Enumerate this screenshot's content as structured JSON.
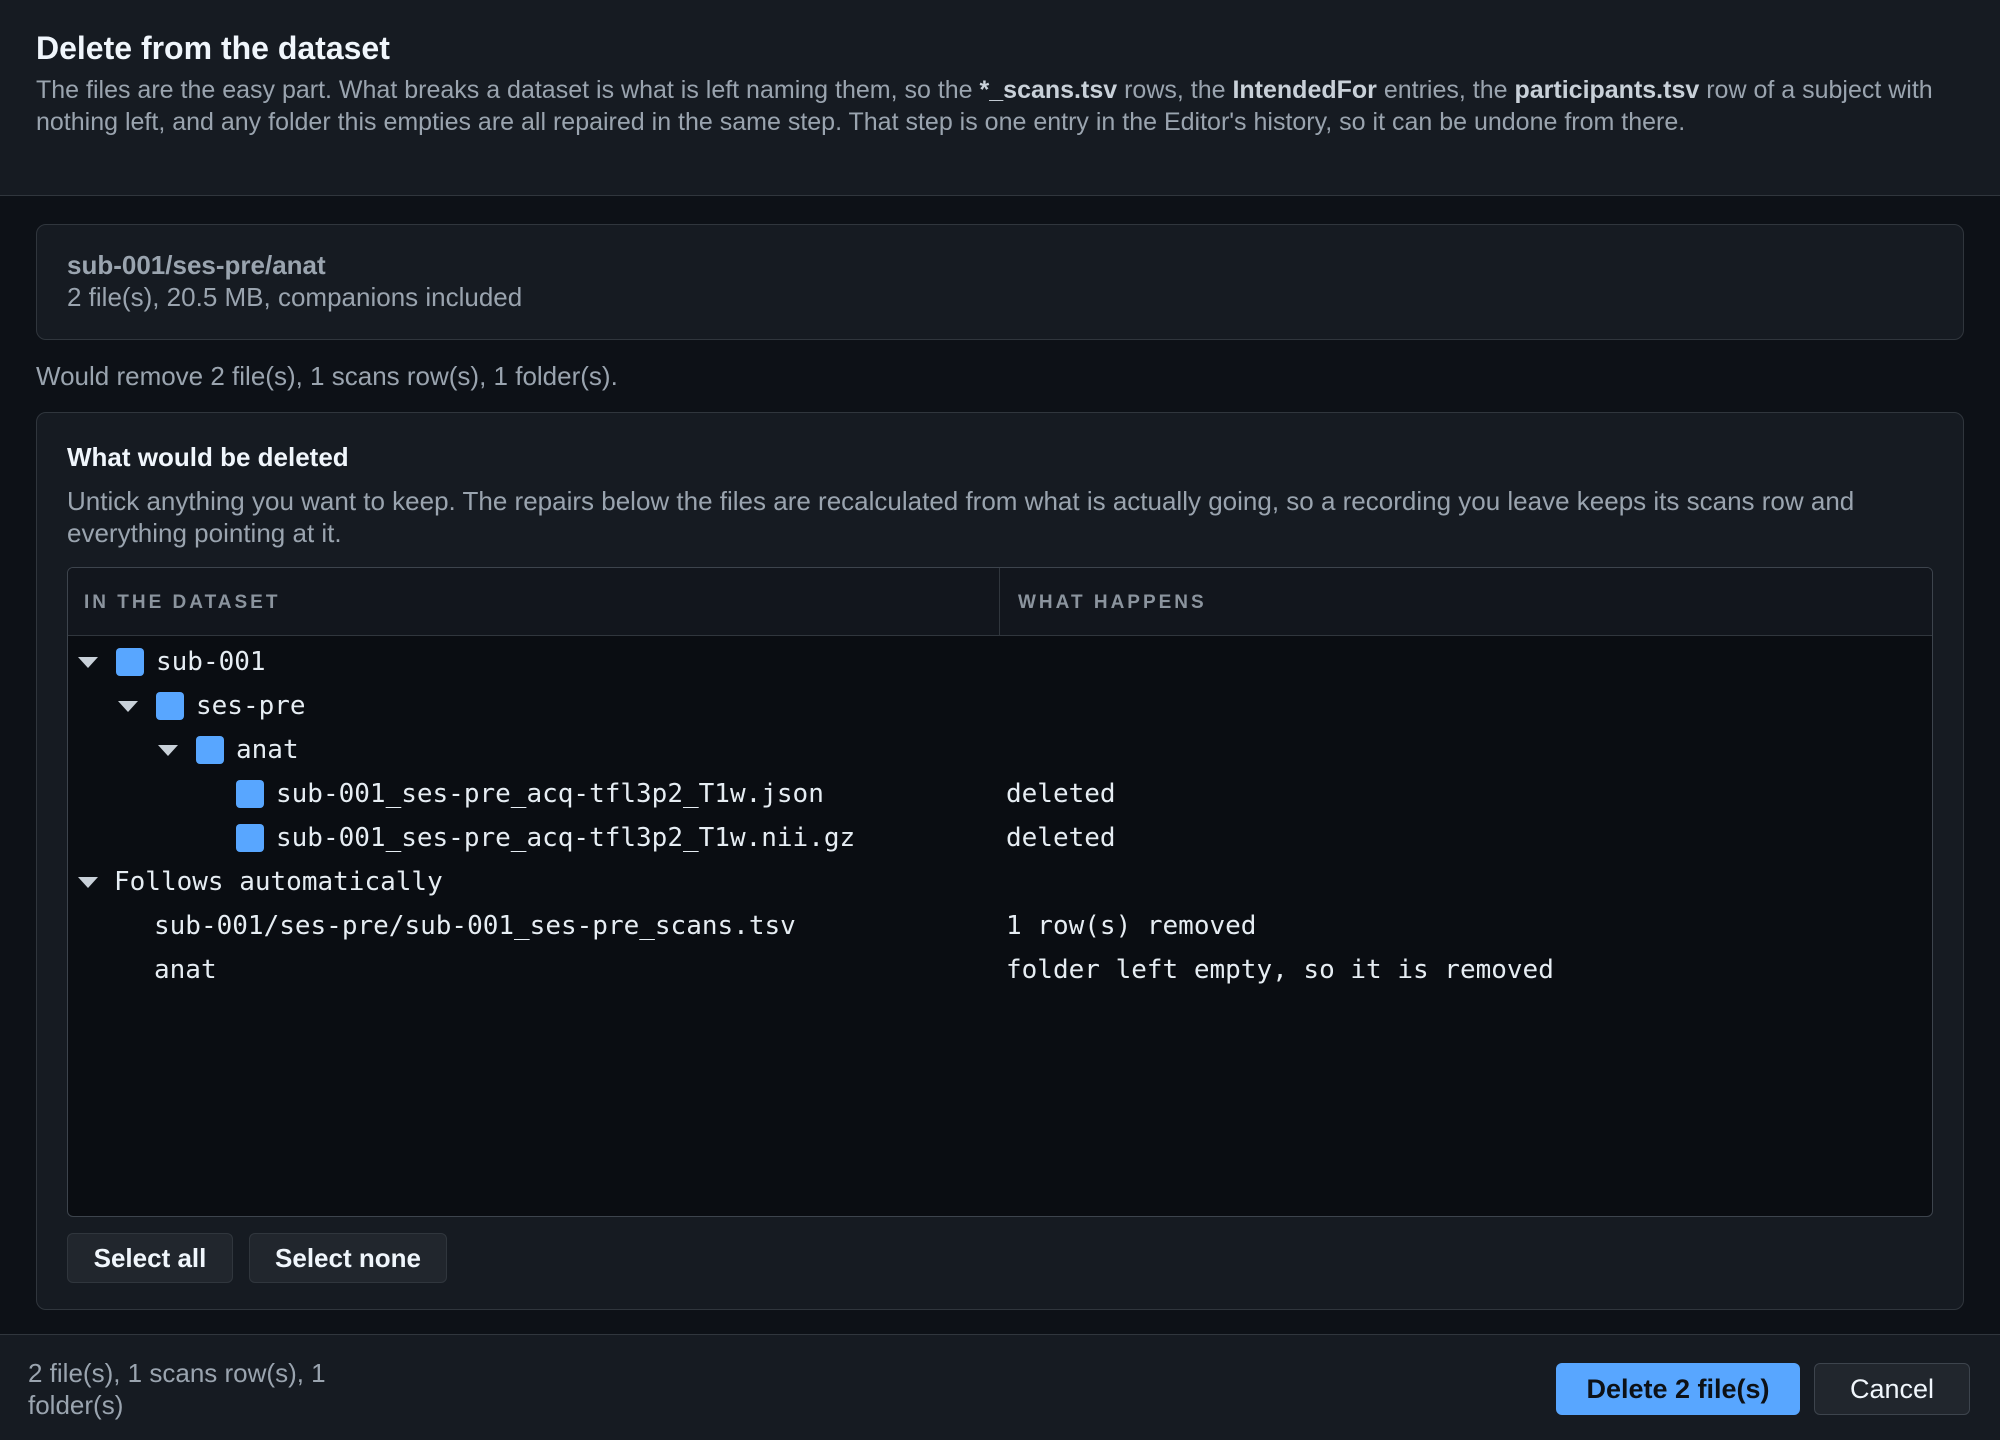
{
  "dialog": {
    "title": "Delete from the dataset",
    "description": {
      "p1": "The files are the easy part. What breaks a dataset is what is left naming them, so the ",
      "b1": "*_scans.tsv",
      "p2": " rows, the ",
      "b2": "IntendedFor",
      "p3": " entries, the ",
      "b3": "participants.tsv",
      "p4": " row of a subject with nothing left, and any folder this empties are all repaired in the same step. That step is one entry in the Editor's history, so it can be undone from there."
    }
  },
  "target": {
    "path": "sub-001/ses-pre/anat",
    "meta": "2 file(s), 20.5 MB, companions included"
  },
  "summary": "Would remove 2 file(s), 1 scans row(s), 1 folder(s).",
  "section": {
    "title": "What would be deleted",
    "hint": "Untick anything you want to keep. The repairs below the files are recalculated from what is actually going, so a recording you leave keeps its scans row and everything pointing at it."
  },
  "tree": {
    "columns": [
      "IN THE DATASET",
      "WHAT HAPPENS"
    ],
    "rows": [
      {
        "name": "sub-001",
        "status": ""
      },
      {
        "name": "ses-pre",
        "status": ""
      },
      {
        "name": "anat",
        "status": ""
      },
      {
        "name": "sub-001_ses-pre_acq-tfl3p2_T1w.json",
        "status": "deleted"
      },
      {
        "name": "sub-001_ses-pre_acq-tfl3p2_T1w.nii.gz",
        "status": "deleted"
      },
      {
        "name": "Follows automatically",
        "status": ""
      },
      {
        "name": "sub-001/ses-pre/sub-001_ses-pre_scans.tsv",
        "status": "1 row(s) removed"
      },
      {
        "name": "anat",
        "status": "folder left empty, so it is removed"
      }
    ]
  },
  "selection": {
    "select_all": "Select all",
    "select_none": "Select none"
  },
  "footer": {
    "counts": "2 file(s), 1 scans row(s), 1 folder(s)",
    "delete_label": "Delete 2 file(s)",
    "cancel_label": "Cancel"
  },
  "colors": {
    "background": "#0d1117",
    "panel": "#161b22",
    "accent": "#58a6ff",
    "checkbox": "#58a6ff"
  }
}
